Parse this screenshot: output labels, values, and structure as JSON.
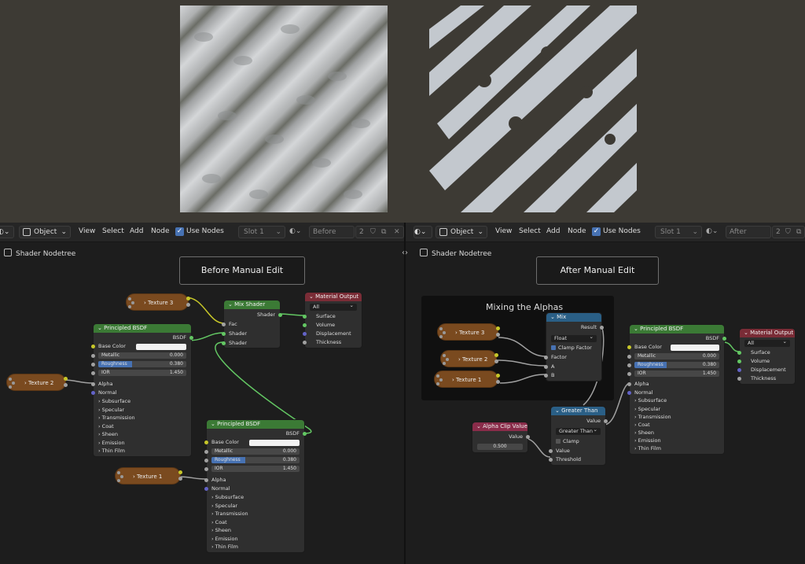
{
  "colors": {
    "viewport_bg": "#3d3a34",
    "node_editor_bg": "#1d1d1d",
    "principled_header": "#3b7a35",
    "mix_header": "#2a5f86",
    "output_header": "#7a2c36",
    "texture_node": "#7a4a1f",
    "accent": "#4772b3",
    "texture_light": "#c9ccd1",
    "texture_dark": "#2b2b2b"
  },
  "header": {
    "mode_label": "Object",
    "menu_view": "View",
    "menu_select": "Select",
    "menu_add": "Add",
    "menu_node": "Node",
    "use_nodes_label": "Use Nodes",
    "slot_label": "Slot 1",
    "users_count": "2"
  },
  "left": {
    "material_name": "Before",
    "breadcrumb": "Shader Nodetree",
    "frame_label": "Before Manual Edit",
    "texture3": "Texture 3",
    "texture2": "Texture 2",
    "texture1": "Texture 1",
    "mix_shader": {
      "title": "Mix Shader",
      "out": "Shader",
      "fac": "Fac",
      "in1": "Shader",
      "in2": "Shader"
    },
    "output": {
      "title": "Material Output",
      "target": "All",
      "surface": "Surface",
      "volume": "Volume",
      "displacement": "Displacement",
      "thickness": "Thickness"
    },
    "bsdf_a": {
      "title": "Principled BSDF",
      "out": "BSDF",
      "base_color": "Base Color",
      "metallic": "Metallic",
      "metallic_v": "0.000",
      "roughness": "Roughness",
      "roughness_v": "0.380",
      "ior": "IOR",
      "ior_v": "1.450",
      "alpha": "Alpha",
      "normal": "Normal",
      "subsurface": "Subsurface",
      "specular": "Specular",
      "transmission": "Transmission",
      "coat": "Coat",
      "sheen": "Sheen",
      "emission": "Emission",
      "thin_film": "Thin Film"
    },
    "bsdf_b": {
      "title": "Principled BSDF",
      "out": "BSDF",
      "base_color": "Base Color",
      "metallic": "Metallic",
      "metallic_v": "0.000",
      "roughness": "Roughness",
      "roughness_v": "0.380",
      "ior": "IOR",
      "ior_v": "1.450",
      "alpha": "Alpha",
      "normal": "Normal",
      "subsurface": "Subsurface",
      "specular": "Specular",
      "transmission": "Transmission",
      "coat": "Coat",
      "sheen": "Sheen",
      "emission": "Emission",
      "thin_film": "Thin Film"
    }
  },
  "right": {
    "material_name": "After",
    "breadcrumb": "Shader Nodetree",
    "frame_label": "After Manual Edit",
    "group_title": "Mixing the Alphas",
    "texture3": "Texture 3",
    "texture2": "Texture 2",
    "texture1": "Texture 1",
    "mix": {
      "title": "Mix",
      "out": "Result",
      "type": "Float",
      "clamp": "Clamp Factor",
      "factor": "Factor",
      "a": "A",
      "b": "B"
    },
    "greater": {
      "title": "Greater Than",
      "out": "Value",
      "op": "Greater Than",
      "clamp": "Clamp",
      "value": "Value",
      "threshold": "Threshold"
    },
    "alpha_clip": {
      "title": "Alpha Clip Value",
      "out": "Value",
      "value": "0.500"
    },
    "output": {
      "title": "Material Output",
      "target": "All",
      "surface": "Surface",
      "volume": "Volume",
      "displacement": "Displacement",
      "thickness": "Thickness"
    },
    "bsdf": {
      "title": "Principled BSDF",
      "out": "BSDF",
      "base_color": "Base Color",
      "metallic": "Metallic",
      "metallic_v": "0.000",
      "roughness": "Roughness",
      "roughness_v": "0.380",
      "ior": "IOR",
      "ior_v": "1.450",
      "alpha": "Alpha",
      "normal": "Normal",
      "subsurface": "Subsurface",
      "specular": "Specular",
      "transmission": "Transmission",
      "coat": "Coat",
      "sheen": "Sheen",
      "emission": "Emission",
      "thin_film": "Thin Film"
    }
  }
}
